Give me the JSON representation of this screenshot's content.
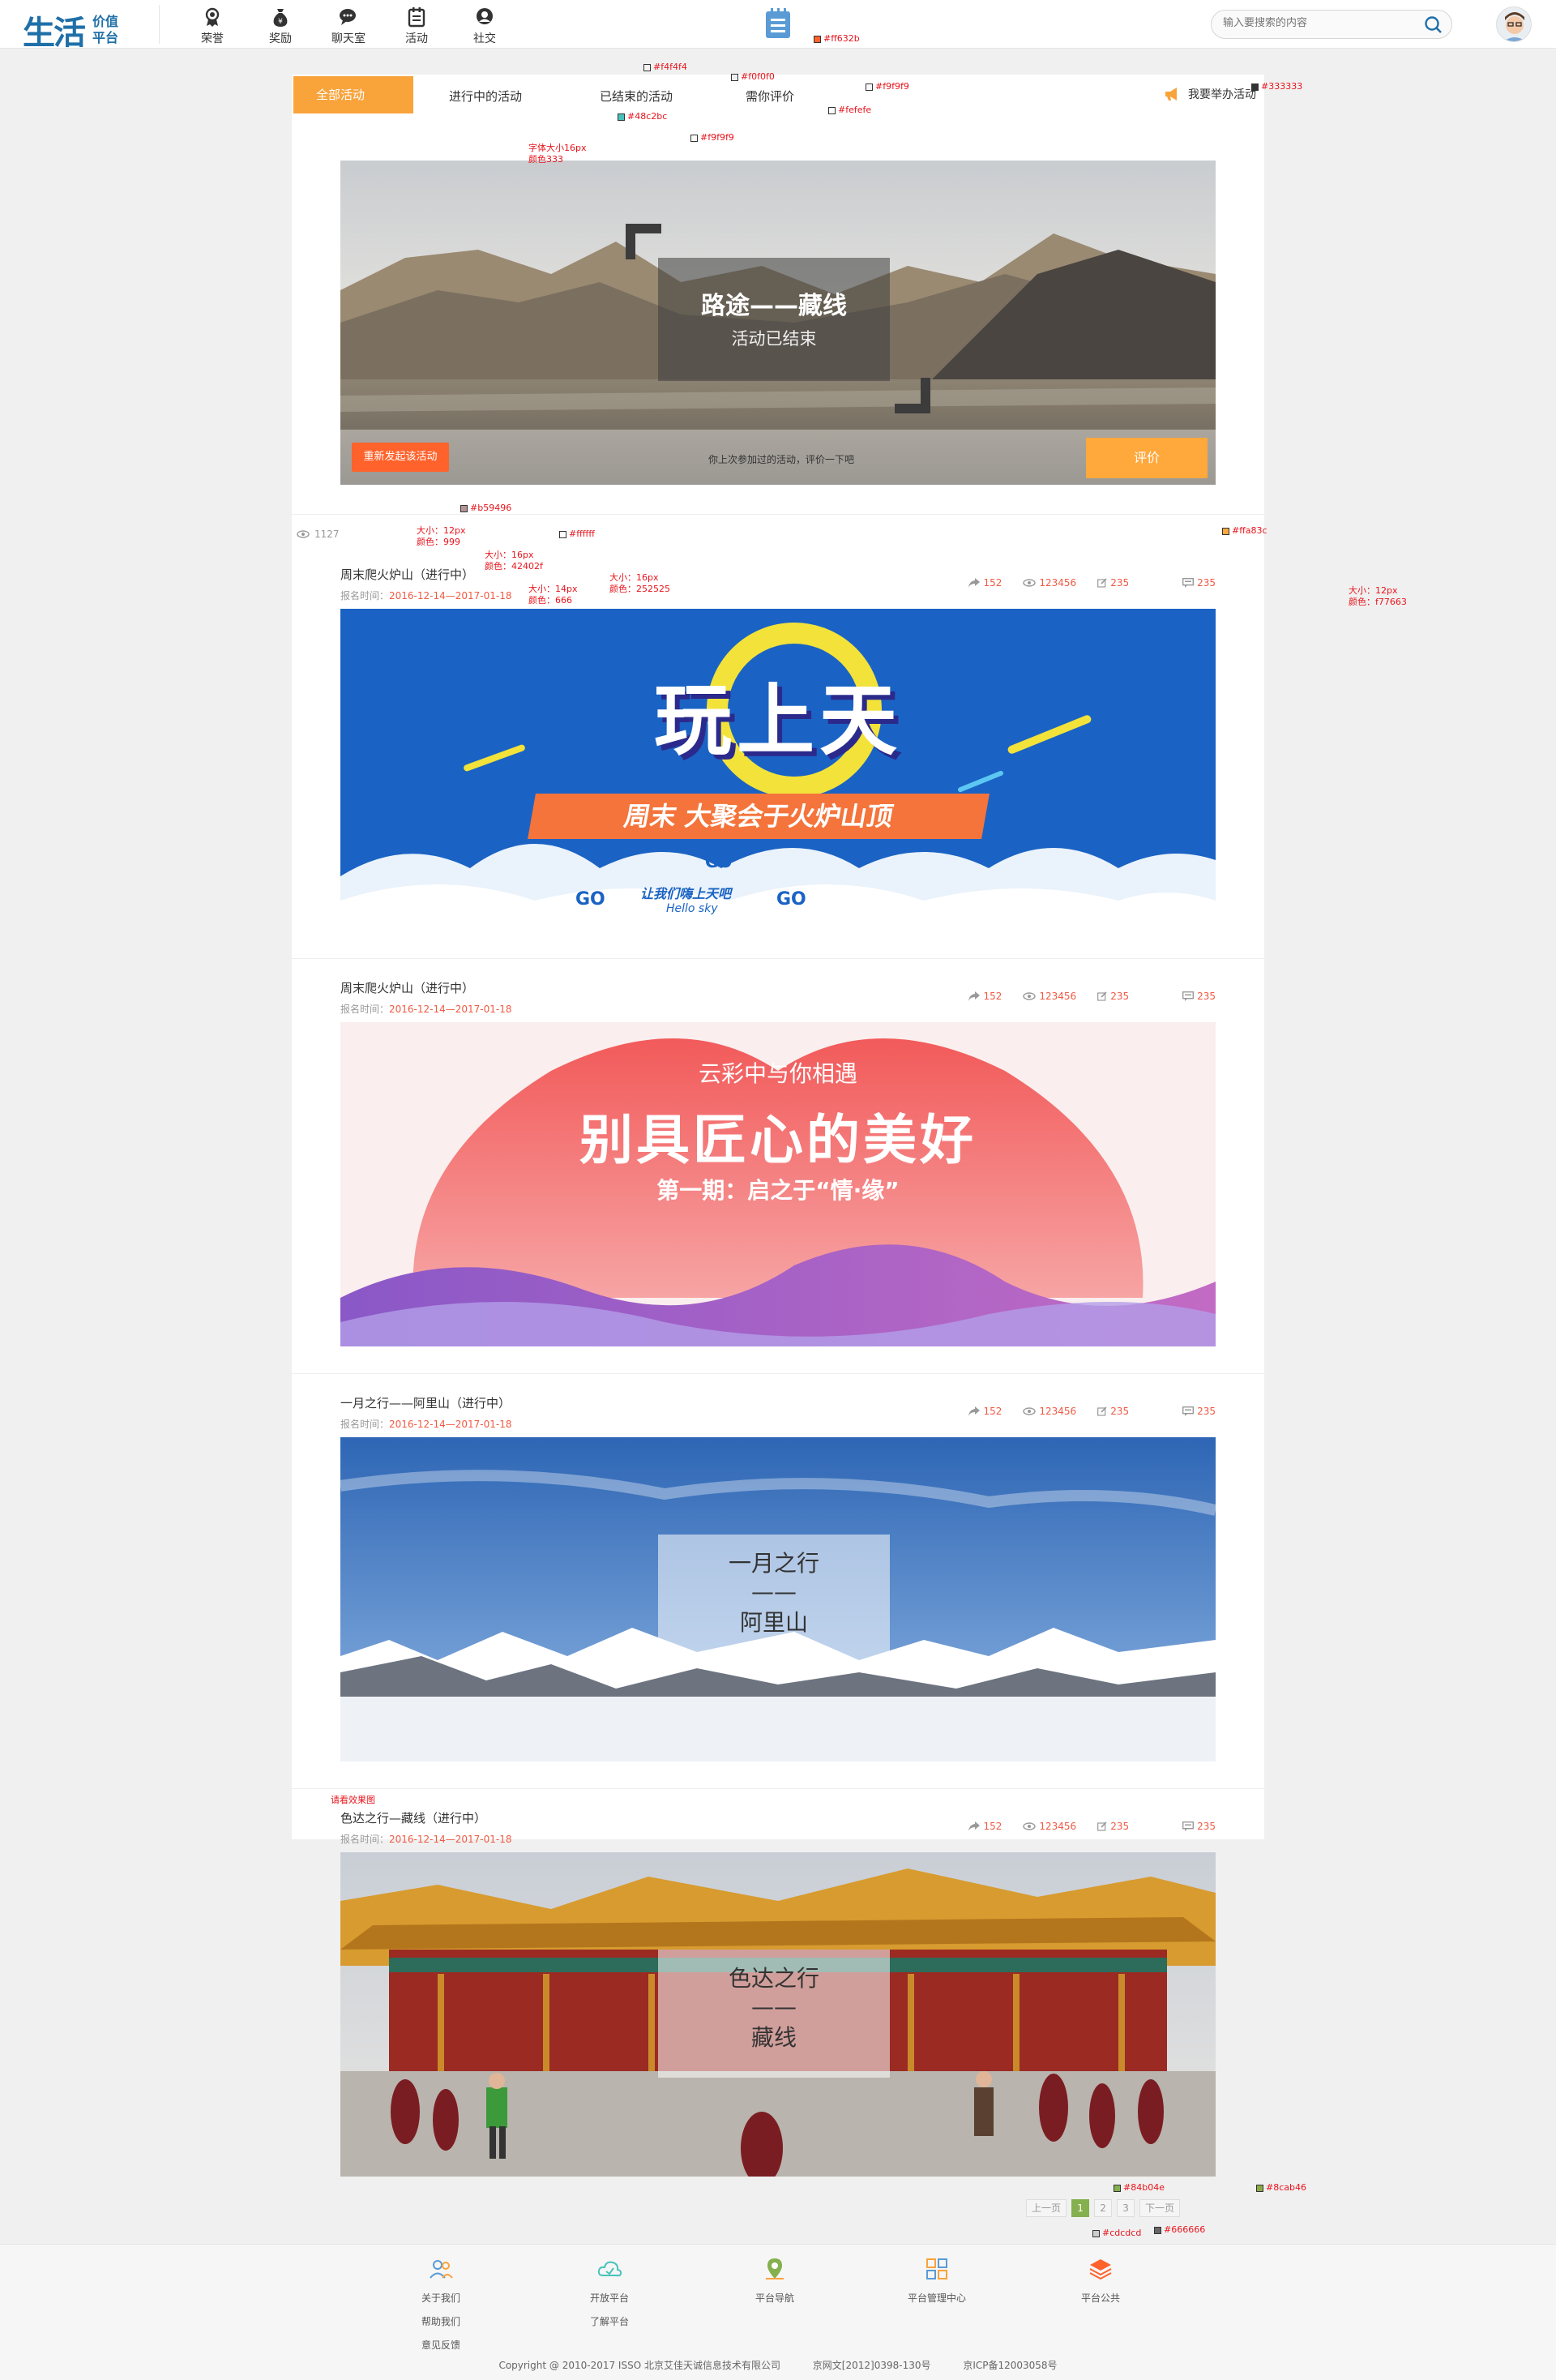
{
  "header": {
    "logo_main": "生活",
    "logo_sub1": "价值",
    "logo_sub2": "平台",
    "nav": [
      {
        "label": "荣誉",
        "icon": "medal-icon"
      },
      {
        "label": "奖励",
        "icon": "money-bag-icon"
      },
      {
        "label": "聊天室",
        "icon": "chat-icon"
      },
      {
        "label": "活动",
        "icon": "calendar-icon"
      },
      {
        "label": "社交",
        "icon": "social-icon"
      }
    ],
    "search_placeholder": "输入要搜索的内容",
    "accent": "#f9a33b",
    "brand": "#1f6fa8"
  },
  "tabs": {
    "all": "全部活动",
    "ongoing": "进行中的活动",
    "ended": "已结束的活动",
    "rate": "需你评价",
    "hold": "我要举办活动"
  },
  "featured": {
    "title": "路途——藏线",
    "subtitle": "活动已结束",
    "hint": "你上次参加过的活动，评价一下吧",
    "repost_btn": "重新发起该活动",
    "rate_btn": "评价"
  },
  "meta_row": {
    "views_label": "1127"
  },
  "activities": [
    {
      "title": "周末爬火炉山（进行中）",
      "time_label": "报名时间：",
      "time": "2016-12-14—2017-01-18",
      "share": "152",
      "views": "123456",
      "edits": "235",
      "comments": "235",
      "banner": {
        "type": "play",
        "big": "玩上天",
        "line": "周末   大聚会于火炉山顶",
        "tag": "让我们嗨上天吧",
        "tag_en": "Hello sky",
        "go": "GO"
      }
    },
    {
      "title": "周末爬火炉山（进行中）",
      "time_label": "报名时间：",
      "time": "2016-12-14—2017-01-18",
      "share": "152",
      "views": "123456",
      "edits": "235",
      "comments": "235",
      "banner": {
        "type": "heart",
        "top": "云彩中与你相遇",
        "big": "别具匠心的美好",
        "sub": "第一期：启之于“情·缘”"
      }
    },
    {
      "title": "一月之行——阿里山（进行中）",
      "time_label": "报名时间：",
      "time": "2016-12-14—2017-01-18",
      "share": "152",
      "views": "123456",
      "edits": "235",
      "comments": "235",
      "banner": {
        "type": "snow",
        "l1": "一月之行",
        "l2": "——",
        "l3": "阿里山"
      }
    },
    {
      "title": "色达之行—藏线（进行中）",
      "time_label": "报名时间：",
      "time": "2016-12-14—2017-01-18",
      "share": "152",
      "views": "123456",
      "edits": "235",
      "comments": "235",
      "banner": {
        "type": "temple",
        "l1": "色达之行",
        "l2": "——",
        "l3": "藏线"
      }
    }
  ],
  "pager": {
    "prev": "上一页",
    "p1": "1",
    "p2": "2",
    "p3": "3",
    "next": "下一页"
  },
  "footer": {
    "cols": [
      {
        "title": "关于我们",
        "links": [
          "帮助我们",
          "意见反馈"
        ],
        "icon": "people-icon"
      },
      {
        "title": "开放平台",
        "links": [
          "了解平台"
        ],
        "icon": "cloud-icon"
      },
      {
        "title": "平台导航",
        "links": [],
        "icon": "map-pin-icon"
      },
      {
        "title": "平台管理中心",
        "links": [],
        "icon": "grid-icon"
      },
      {
        "title": "平台公共",
        "links": [],
        "icon": "layers-icon"
      }
    ],
    "copyright": "Copyright @ 2010-2017 ISSO 北京艾佳天诚信息技术有限公司",
    "license1": "京网文[2012]0398-130号",
    "license2": "京ICP备12003058号"
  },
  "annotations": {
    "c1": "#ff632b",
    "c2": "#f4f4f4",
    "c3": "#f0f0f0",
    "c4": "#f9f9f9",
    "c5": "#48c2bc",
    "c6": "#fefefe",
    "c7": "#333333",
    "c8": "#ffa83c",
    "c9": "#b59496",
    "c10": "#ffffff",
    "c11": "#84b04e",
    "c12": "#8cab46",
    "c13": "#cdcdcd",
    "c14": "#666666",
    "font16": "字体大小16px",
    "color333": "颜色333",
    "size12": "大小：12px",
    "color999": "颜色：999",
    "size16": "大小：16px",
    "color42": "颜色：42402f",
    "color25": "颜色：252525",
    "size14": "大小：14px",
    "color666": "颜色：666",
    "colorf76": "颜色：f77663",
    "look": "请看效果图"
  }
}
